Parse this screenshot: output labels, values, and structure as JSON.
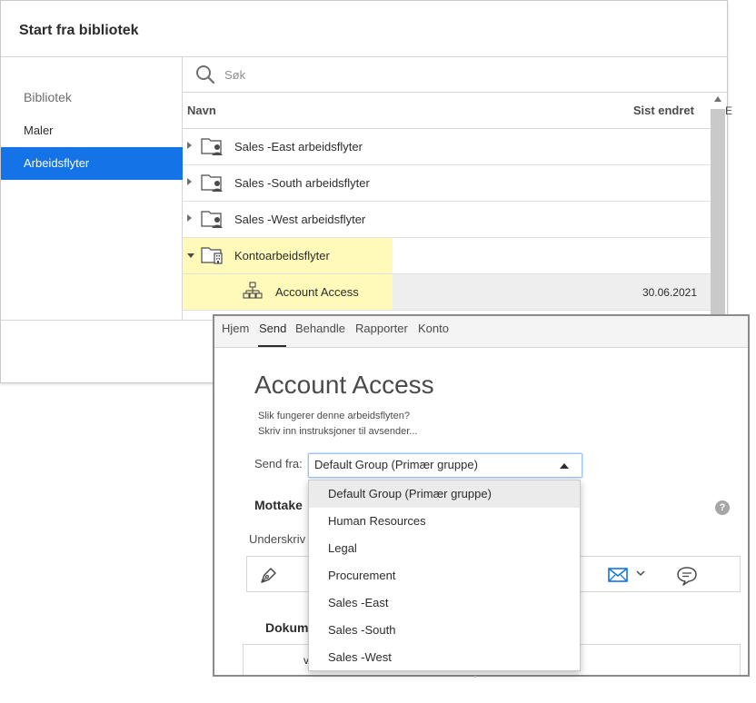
{
  "library_dialog": {
    "title": "Start fra bibliotek",
    "nav": {
      "heading": "Bibliotek",
      "items": [
        {
          "label": "Maler",
          "selected": false
        },
        {
          "label": "Arbeidsflyter",
          "selected": true
        }
      ]
    },
    "search": {
      "placeholder": "Søk",
      "value": ""
    },
    "columns": {
      "name": "Navn",
      "date": "Sist endret"
    },
    "rows": [
      {
        "label": "Sales -East arbeidsflyter",
        "icon": "shared-folder-icon",
        "expanded": false,
        "date": ""
      },
      {
        "label": "Sales -South arbeidsflyter",
        "icon": "shared-folder-icon",
        "expanded": false,
        "date": ""
      },
      {
        "label": "Sales -West arbeidsflyter",
        "icon": "shared-folder-icon",
        "expanded": false,
        "date": ""
      },
      {
        "label": "Kontoarbeidsflyter",
        "icon": "account-folder-icon",
        "expanded": true,
        "date": ""
      },
      {
        "label": "Account Access",
        "icon": "workflow-icon",
        "expanded": false,
        "date": "30.06.2021"
      }
    ],
    "edge_text": "E",
    "highlight_color": "#fffab9"
  },
  "send_panel": {
    "tabs": [
      {
        "label": "Hjem",
        "active": false
      },
      {
        "label": "Send",
        "active": true
      },
      {
        "label": "Behandle",
        "active": false
      },
      {
        "label": "Rapporter",
        "active": false
      },
      {
        "label": "Konto",
        "active": false
      }
    ],
    "workflow_title": "Account Access",
    "description_line1": "Slik fungerer denne arbeidsflyten?",
    "description_line2": "Skriv inn instruksjoner til avsender...",
    "send_from": {
      "label": "Send fra:",
      "selected": "Default Group (Primær gruppe)",
      "options": [
        "Default Group (Primær gruppe)",
        "Human Resources",
        "Legal",
        "Procurement",
        "Sales -East",
        "Sales -South",
        "Sales -West"
      ],
      "hovered_option": "Default Group (Primær gruppe)"
    },
    "recipients_heading": "Mottake",
    "signer_label": "Underskriv",
    "documents_heading": "Dokum",
    "documents_fragment": "v",
    "help_icon": "?",
    "icons": [
      "pen-icon",
      "mail-icon",
      "chevron-down-icon",
      "chat-icon",
      "help-icon"
    ],
    "accent_color": "#1473e6"
  }
}
